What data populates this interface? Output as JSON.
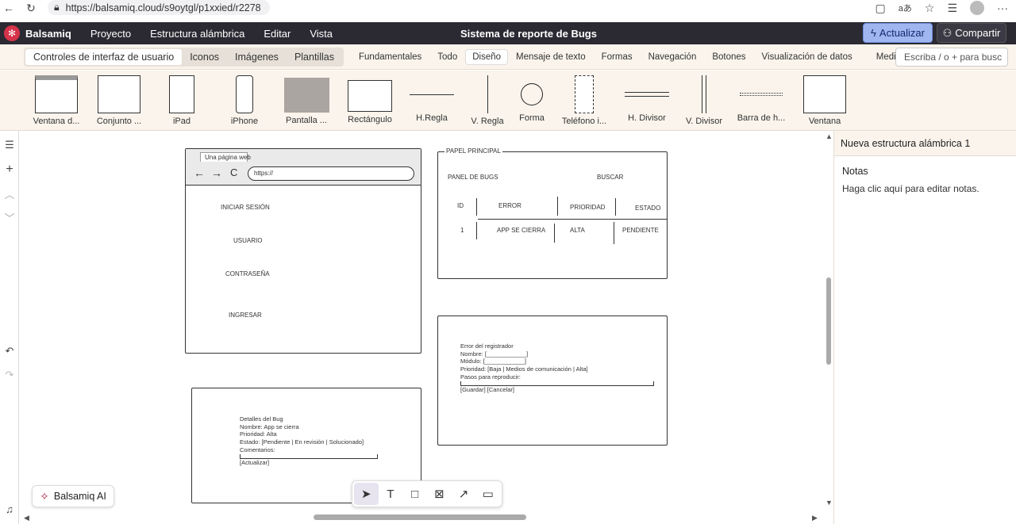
{
  "browser": {
    "url": "https://balsamiq.cloud/s9oytgl/p1xxied/r2278"
  },
  "app": {
    "menu": [
      "Balsamiq",
      "Proyecto",
      "Estructura alámbrica",
      "Editar",
      "Vista"
    ],
    "title": "Sistema de reporte de Bugs",
    "update_label": "Actualizar",
    "share_label": "Compartir"
  },
  "library": {
    "groups": [
      "Controles de interfaz de usuario",
      "Iconos",
      "Imágenes",
      "Plantillas"
    ],
    "categories": [
      "Fundamentales",
      "Todo",
      "Diseño",
      "Mensaje de texto",
      "Formas",
      "Navegación",
      "Botones",
      "Visualización de datos",
      "Medi"
    ],
    "search_placeholder": "Escriba / o + para busc"
  },
  "components": [
    "Ventana d...",
    "Conjunto ...",
    "iPad",
    "iPhone",
    "Pantalla ...",
    "Rectángulo",
    "H.Regla",
    "V. Regla",
    "Forma",
    "Teléfono i...",
    "H. Divisor",
    "V. Divisor",
    "Barra de h...",
    "Ventana"
  ],
  "wireframes": {
    "login": {
      "tab": "Una página web",
      "url": "https://",
      "fields": [
        "INICIAR SESIÓN",
        "USUARIO",
        "CONTRASEÑA",
        "INGRESAR"
      ]
    },
    "panel": {
      "legend": "PAPEL PRINCIPAL",
      "title": "PANEL DE BUGS",
      "search": "BUSCAR",
      "headers": [
        "ID",
        "ERROR",
        "PRIORIDAD",
        "ESTADO"
      ],
      "row": [
        "1",
        "APP SE CIERRA",
        "ALTA",
        "PENDIENTE"
      ]
    },
    "registrador": {
      "lines": [
        "Error del registrador",
        "Nombre: [____________]",
        "Módulo: [____________]",
        "Prioridad: [Baja | Medios de comunicación | Alta]",
        "Pasos para reproducir:",
        "[______________________________________________________]",
        "[Guardar]   [Cancelar]"
      ]
    },
    "detalles": {
      "lines": [
        "Detalles del Bug",
        "Nombre: App se cierra",
        "Prioridad: Alta",
        "Estado: [Pendiente | En revisión | Solucionado]",
        "Comentarios:",
        "[_______________________________________________]",
        "[Actualizar]"
      ]
    }
  },
  "right_panel": {
    "title": "Nueva estructura alámbrica 1",
    "notes_title": "Notas",
    "notes_body": "Haga clic aquí para editar notas."
  },
  "ai_button": "Balsamiq AI",
  "tool_hints": [
    "V",
    "T",
    "R",
    "O",
    "Un",
    "C"
  ]
}
